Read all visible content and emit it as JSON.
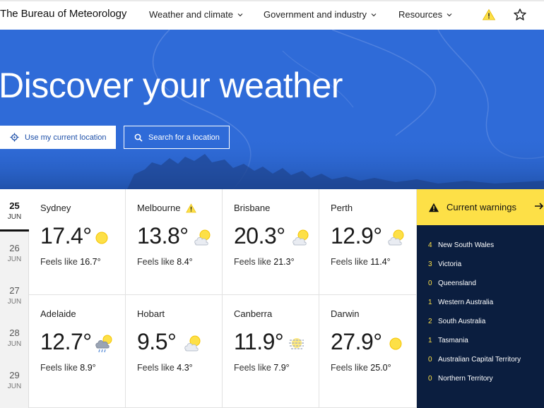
{
  "header": {
    "brand": "The Bureau of Meteorology",
    "nav": [
      {
        "label": "Weather and climate"
      },
      {
        "label": "Government and industry"
      },
      {
        "label": "Resources"
      }
    ]
  },
  "hero": {
    "title": "Discover your weather",
    "location_button": "Use my current location",
    "search_button": "Search for a location"
  },
  "dates": [
    {
      "day": "25",
      "month": "JUN",
      "active": true
    },
    {
      "day": "26",
      "month": "JUN"
    },
    {
      "day": "27",
      "month": "JUN"
    },
    {
      "day": "28",
      "month": "JUN"
    },
    {
      "day": "29",
      "month": "JUN"
    }
  ],
  "feels_label": "Feels like",
  "cities": [
    {
      "name": "Sydney",
      "temp": "17.4°",
      "feels": "16.7°",
      "icon": "sunny-icon"
    },
    {
      "name": "Melbourne",
      "temp": "13.8°",
      "feels": "8.4°",
      "icon": "partly-cloudy-icon",
      "warning": true
    },
    {
      "name": "Brisbane",
      "temp": "20.3°",
      "feels": "21.3°",
      "icon": "partly-cloudy-icon"
    },
    {
      "name": "Perth",
      "temp": "12.9°",
      "feels": "11.4°",
      "icon": "partly-cloudy-icon"
    },
    {
      "name": "Adelaide",
      "temp": "12.7°",
      "feels": "8.9°",
      "icon": "showers-icon"
    },
    {
      "name": "Hobart",
      "temp": "9.5°",
      "feels": "4.3°",
      "icon": "partly-cloudy-icon"
    },
    {
      "name": "Canberra",
      "temp": "11.9°",
      "feels": "7.9°",
      "icon": "haze-icon"
    },
    {
      "name": "Darwin",
      "temp": "27.9°",
      "feels": "25.0°",
      "icon": "sunny-icon"
    }
  ],
  "warnings": {
    "title": "Current warnings",
    "items": [
      {
        "count": "4",
        "region": "New South Wales"
      },
      {
        "count": "3",
        "region": "Victoria"
      },
      {
        "count": "0",
        "region": "Queensland"
      },
      {
        "count": "1",
        "region": "Western Australia"
      },
      {
        "count": "2",
        "region": "South Australia"
      },
      {
        "count": "1",
        "region": "Tasmania"
      },
      {
        "count": "0",
        "region": "Australian Capital Territory"
      },
      {
        "count": "0",
        "region": "Northern Territory"
      }
    ]
  },
  "colors": {
    "hero_blue": "#2f6bd8",
    "warning_yellow": "#fde047",
    "navy": "#0b1e3f",
    "link_blue": "#1d4fa8"
  }
}
